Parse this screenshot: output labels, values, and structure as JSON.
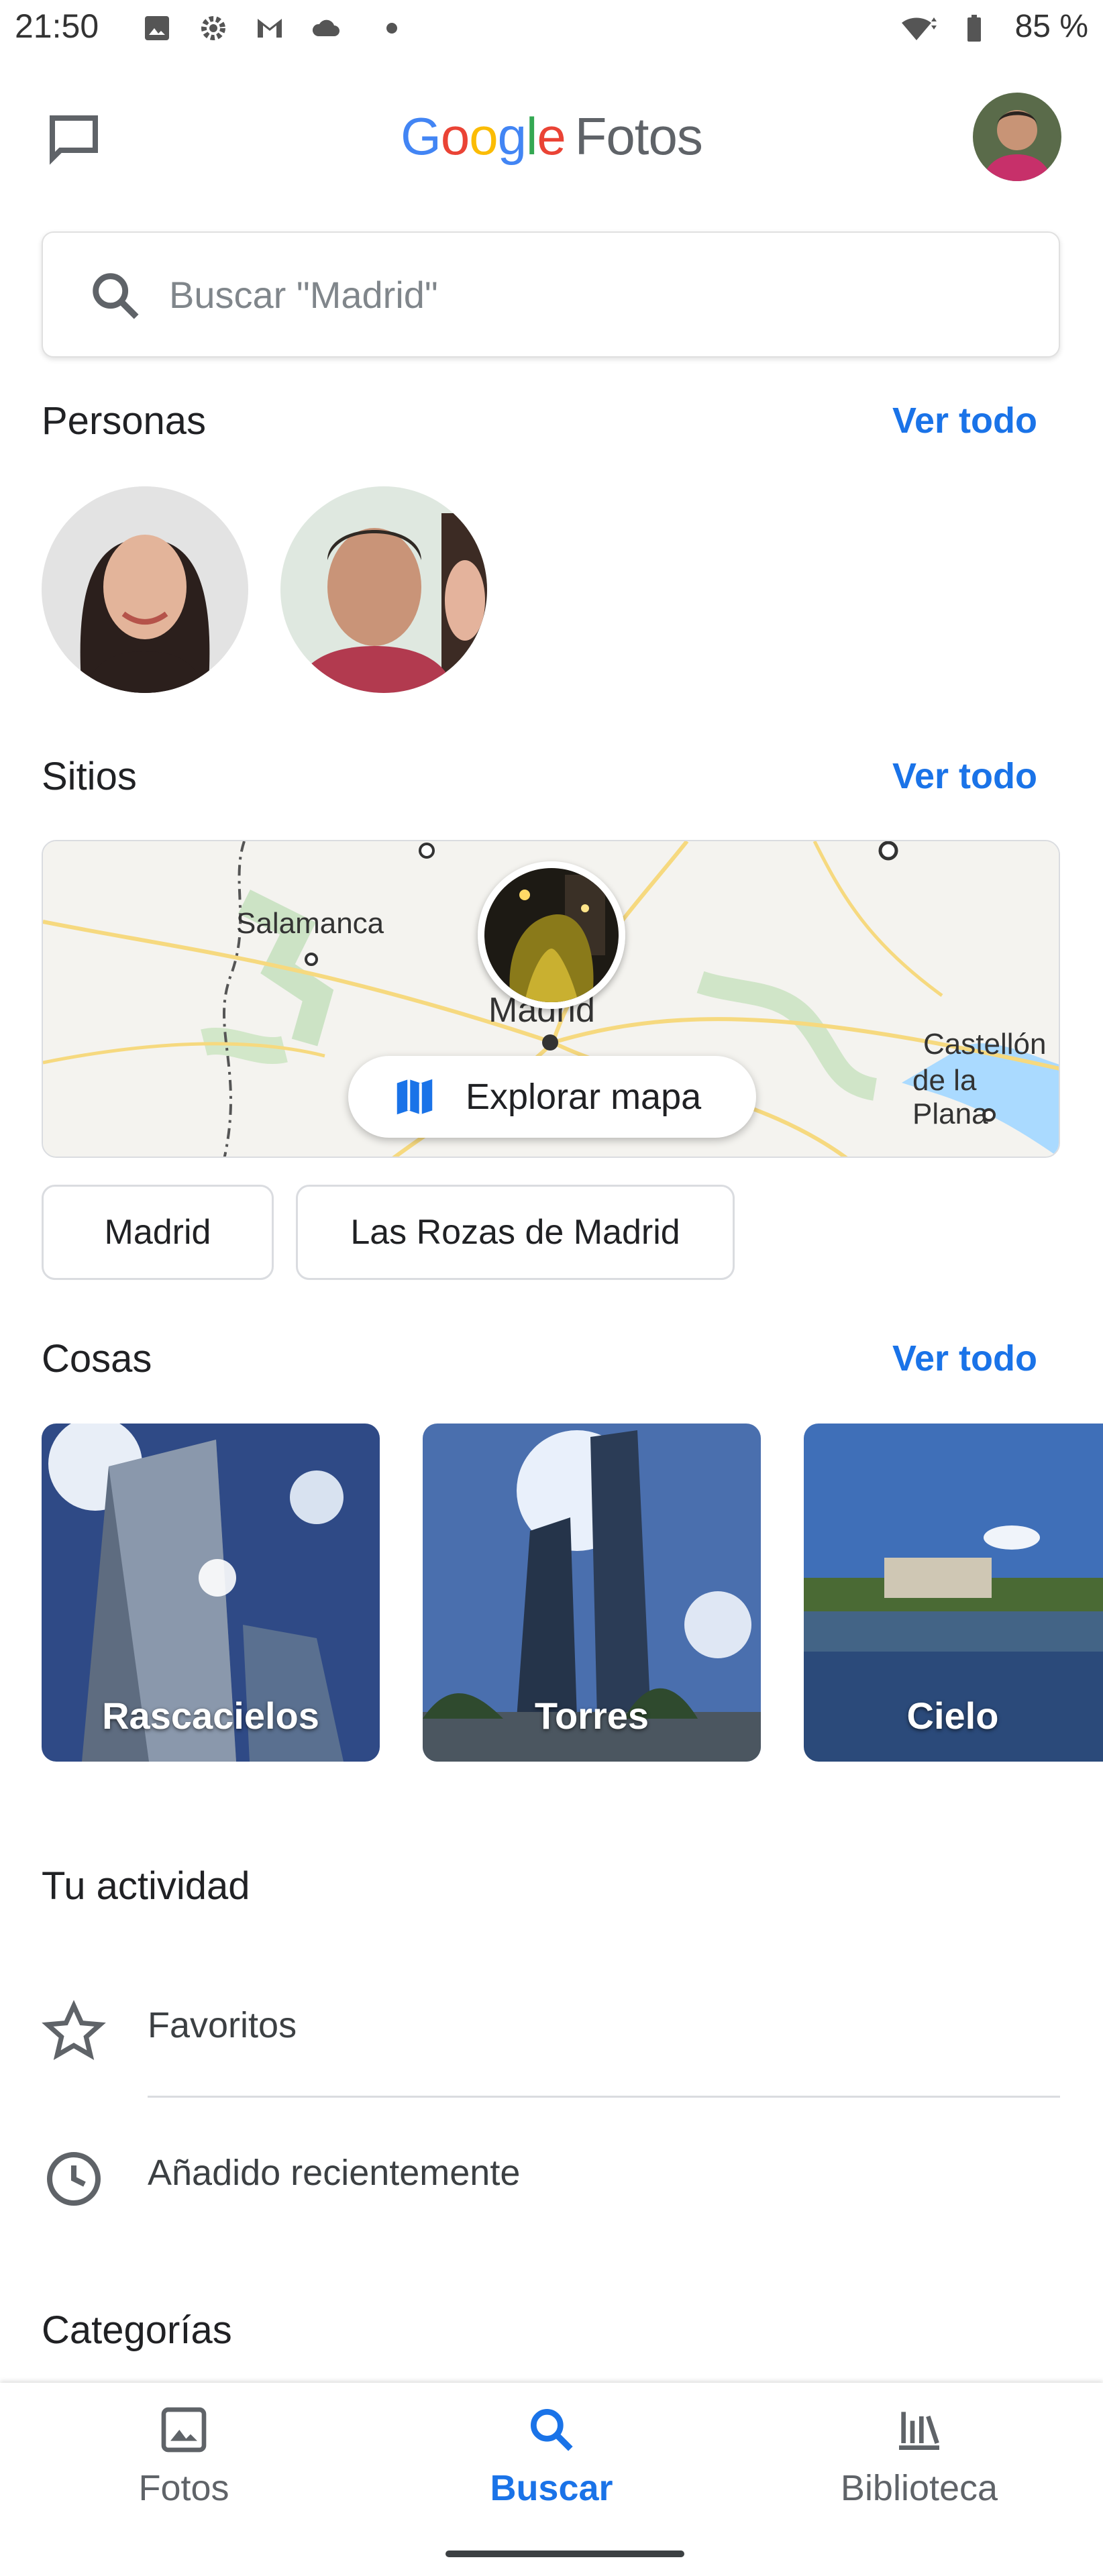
{
  "status_bar": {
    "time": "21:50",
    "battery": "85 %"
  },
  "header": {
    "logo_google": [
      "G",
      "o",
      "o",
      "g",
      "l",
      "e"
    ],
    "logo_product": "Fotos"
  },
  "search": {
    "placeholder": "Buscar \"Madrid\""
  },
  "people": {
    "title": "Personas",
    "see_all": "Ver todo"
  },
  "places": {
    "title": "Sitios",
    "see_all": "Ver todo",
    "map_labels": {
      "salamanca": "Salamanca",
      "madrid": "Madrid",
      "castellon_1": "Castellón",
      "castellon_2": "de la Plana"
    },
    "explore_label": "Explorar mapa",
    "chips": [
      "Madrid",
      "Las Rozas de Madrid"
    ]
  },
  "things": {
    "title": "Cosas",
    "see_all": "Ver todo",
    "items": [
      "Rascacielos",
      "Torres",
      "Cielo"
    ]
  },
  "activity": {
    "title": "Tu actividad",
    "items": [
      "Favoritos",
      "Añadido recientemente"
    ]
  },
  "categories": {
    "title": "Categorías"
  },
  "bottom_nav": {
    "items": [
      "Fotos",
      "Buscar",
      "Biblioteca"
    ],
    "active": "Buscar"
  },
  "colors": {
    "accent": "#1a73e8",
    "text": "#202124",
    "muted": "#5f6368"
  }
}
